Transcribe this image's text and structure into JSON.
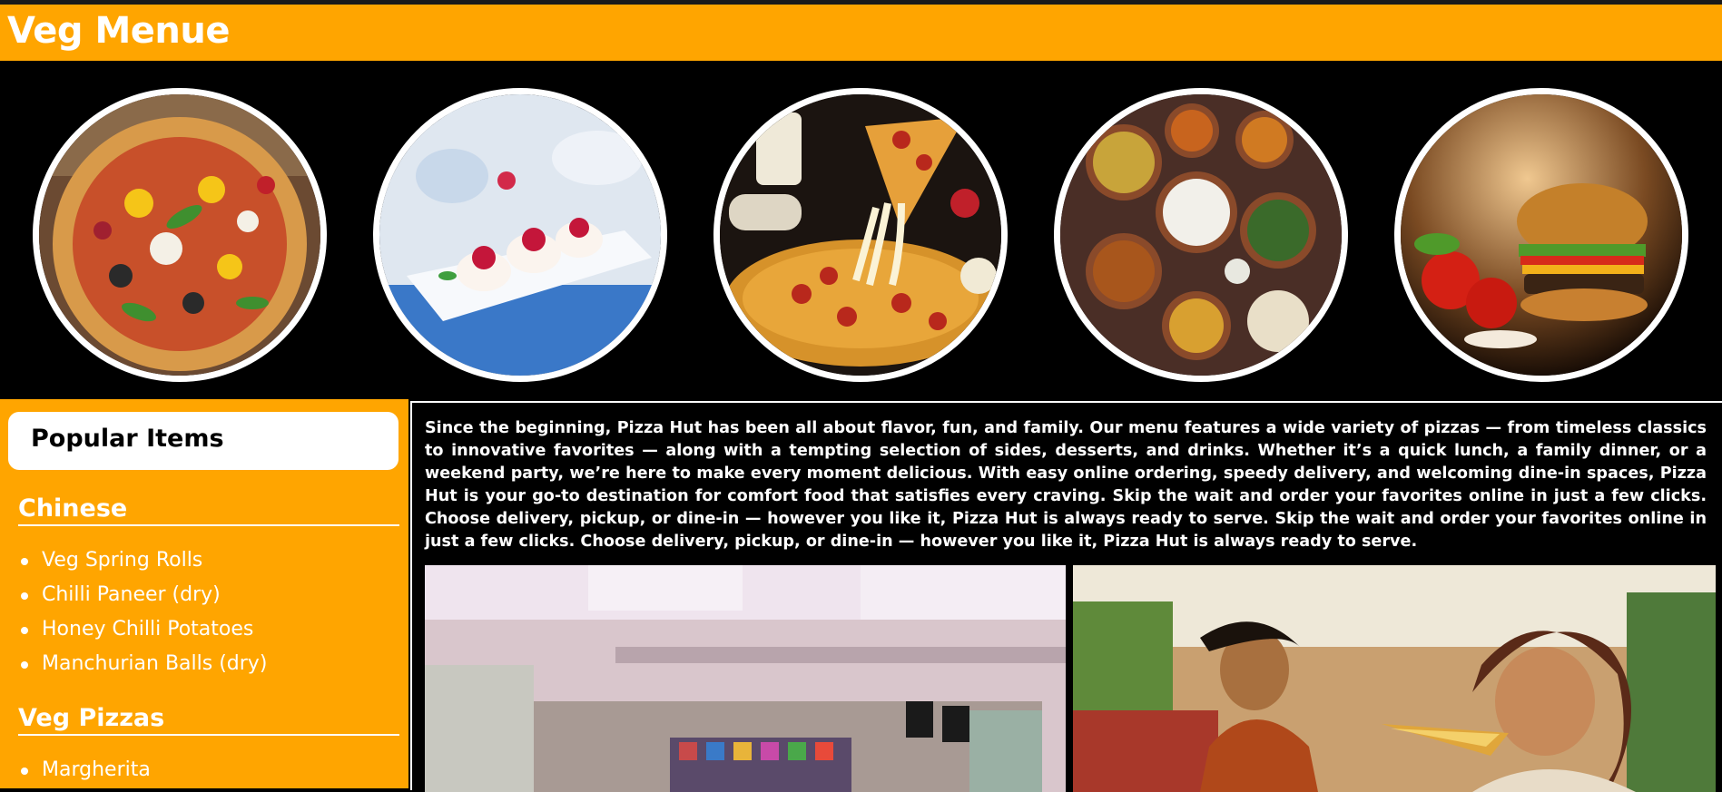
{
  "header": {
    "title": "Veg Menue",
    "accent_color": "#ffa500"
  },
  "gallery": {
    "images": [
      {
        "name": "veg-pizza-image"
      },
      {
        "name": "dessert-image"
      },
      {
        "name": "cheese-pizza-image"
      },
      {
        "name": "indian-thali-image"
      },
      {
        "name": "burger-image"
      }
    ]
  },
  "sidebar": {
    "heading": "Popular Items",
    "categories": [
      {
        "title": "Chinese",
        "items": [
          "Veg Spring Rolls",
          "Chilli Paneer (dry)",
          "Honey Chilli Potatoes",
          "Manchurian Balls (dry)"
        ]
      },
      {
        "title": "Veg Pizzas",
        "items": [
          "Margherita"
        ]
      }
    ]
  },
  "main": {
    "description": "Since the beginning, Pizza Hut has been all about flavor, fun, and family. Our menu features a wide variety of pizzas — from timeless classics to innovative favorites — along with a tempting selection of sides, desserts, and drinks. Whether it’s a quick lunch, a family dinner, or a weekend party, we’re here to make every moment delicious. With easy online ordering, speedy delivery, and welcoming dine-in spaces, Pizza Hut is your go-to destination for comfort food that satisfies every craving. Skip the wait and order your favorites online in just a few clicks. Choose delivery, pickup, or dine-in — however you like it, Pizza Hut is always ready to serve. Skip the wait and order your favorites online in just a few clicks. Choose delivery, pickup, or dine-in — however you like it, Pizza Hut is always ready to serve."
  }
}
